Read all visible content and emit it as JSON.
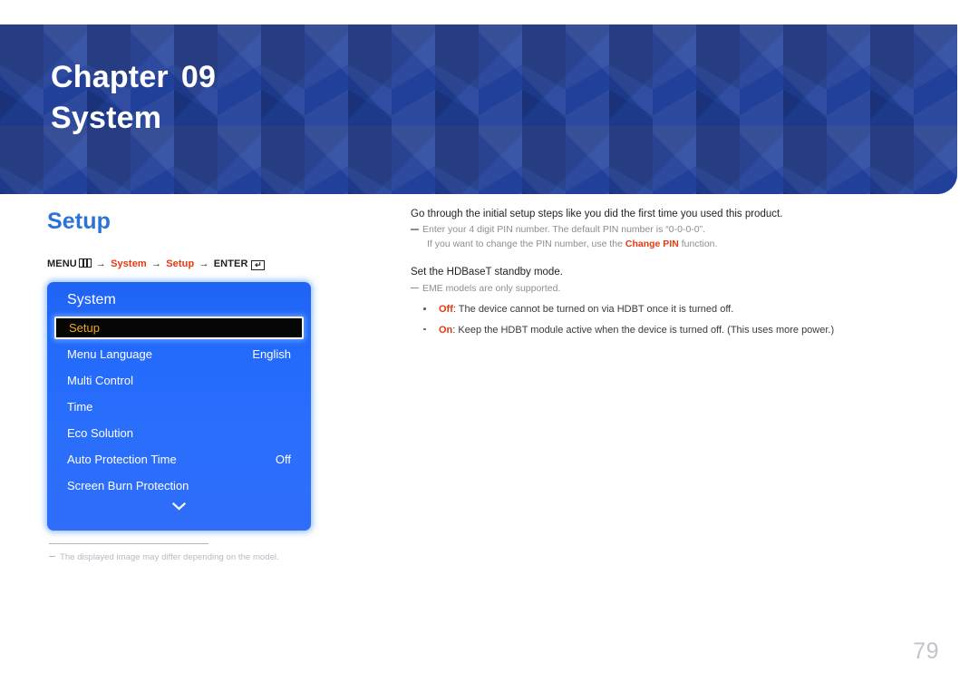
{
  "banner": {
    "chapter_label": "Chapter",
    "chapter_number": "09",
    "chapter_title": "System",
    "background_color": "#21409a"
  },
  "section": {
    "title": "Setup",
    "title_color": "#2b73d8"
  },
  "menu_path": {
    "menu_label": "MENU",
    "menu_icon": "menu-bars-icon",
    "arrow": "→",
    "step1": "System",
    "step2": "Setup",
    "enter_label": "ENTER",
    "enter_icon": "enter-key-icon",
    "enter_glyph": "↵",
    "accent_color": "#e8380d"
  },
  "osd": {
    "header": "System",
    "items": [
      {
        "label": "Setup",
        "value": "",
        "selected": true
      },
      {
        "label": "Menu Language",
        "value": "English",
        "selected": false
      },
      {
        "label": "Multi Control",
        "value": "",
        "selected": false
      },
      {
        "label": "Time",
        "value": "",
        "selected": false
      },
      {
        "label": "Eco Solution",
        "value": "",
        "selected": false
      },
      {
        "label": "Auto Protection Time",
        "value": "Off",
        "selected": false
      },
      {
        "label": "Screen Burn Protection",
        "value": "",
        "selected": false
      }
    ],
    "scroll_down_icon": "chevron-down-icon",
    "selected_text_color": "#f0a81e",
    "panel_color": "#2269fb"
  },
  "left_footnote": {
    "text": "The displayed image may differ depending on the model."
  },
  "content": {
    "intro": "Go through the initial setup steps like you did the first time you used this product.",
    "note1_line1_a": "Enter your 4 digit PIN number. The default PIN number is “0-0-0-0”.",
    "note1_line2_a": "If you want to change the PIN number, use the ",
    "note1_line2_hl": "Change PIN",
    "note1_line2_b": " function.",
    "hdbaset_intro": "Set the HDBaseT standby mode.",
    "note2": "EME models are only supported.",
    "bullets": [
      {
        "option": "Off",
        "text": ": The device cannot be turned on via HDBT once it is turned off."
      },
      {
        "option": "On",
        "text": ": Keep the HDBT module active when the device is turned off. (This uses more power.)"
      }
    ]
  },
  "page_number": "79"
}
